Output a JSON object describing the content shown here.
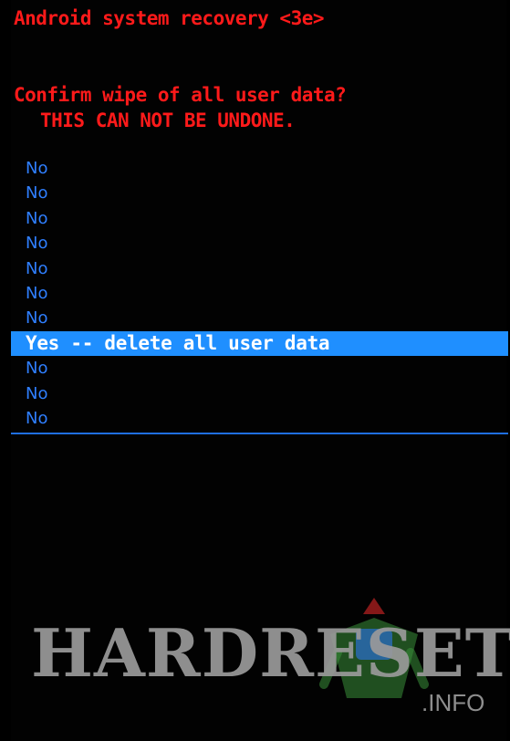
{
  "header": {
    "title": "Android system recovery <3e>"
  },
  "dialog": {
    "confirm_text": "Confirm wipe of all user data?",
    "warning_text": "THIS CAN NOT BE UNDONE."
  },
  "menu": {
    "selected_index": 7,
    "items": [
      {
        "label": "No"
      },
      {
        "label": "No"
      },
      {
        "label": "No"
      },
      {
        "label": "No"
      },
      {
        "label": "No"
      },
      {
        "label": "No"
      },
      {
        "label": "No"
      },
      {
        "label": "Yes -- delete all user data"
      },
      {
        "label": "No"
      },
      {
        "label": "No"
      },
      {
        "label": "No"
      }
    ]
  },
  "watermark": {
    "brand": "HARDRESET",
    "suffix": ".INFO"
  },
  "colors": {
    "background": "#000000",
    "header_text": "#ff1a1a",
    "menu_text": "#2f7fff",
    "highlight": "#1f8fff",
    "highlight_text": "#ffffff",
    "divider": "#1f6fe0"
  }
}
